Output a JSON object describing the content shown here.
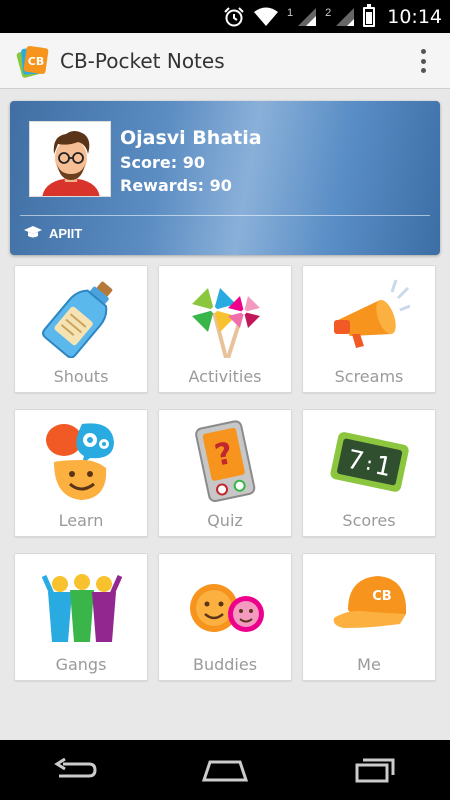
{
  "status_bar": {
    "sim1_label": "1",
    "sim2_label": "2",
    "time": "10:14",
    "icons": [
      "alarm-icon",
      "wifi-icon",
      "signal-icon",
      "battery-icon"
    ]
  },
  "app_bar": {
    "title": "CB-Pocket Notes",
    "logo_text": "CB",
    "menu_icon": "overflow-menu-icon"
  },
  "profile": {
    "name": "Ojasvi Bhatia",
    "score_text": "Score: 90",
    "rewards_text": "Rewards: 90",
    "institution": "APIIT"
  },
  "tiles": [
    {
      "label": "Shouts",
      "icon": "bottle-message-icon"
    },
    {
      "label": "Activities",
      "icon": "pinwheel-icon"
    },
    {
      "label": "Screams",
      "icon": "megaphone-icon"
    },
    {
      "label": "Learn",
      "icon": "brain-gears-icon"
    },
    {
      "label": "Quiz",
      "icon": "quiz-tablet-icon"
    },
    {
      "label": "Scores",
      "icon": "scoreboard-icon"
    },
    {
      "label": "Gangs",
      "icon": "group-people-icon"
    },
    {
      "label": "Buddies",
      "icon": "buddies-faces-icon"
    },
    {
      "label": "Me",
      "icon": "cap-icon"
    }
  ],
  "colors": {
    "card_gradient_start": "#3f6fa3",
    "card_gradient_mid": "#8ab0d9",
    "tile_label": "#9a9a9a",
    "accent_orange": "#f7941d"
  }
}
